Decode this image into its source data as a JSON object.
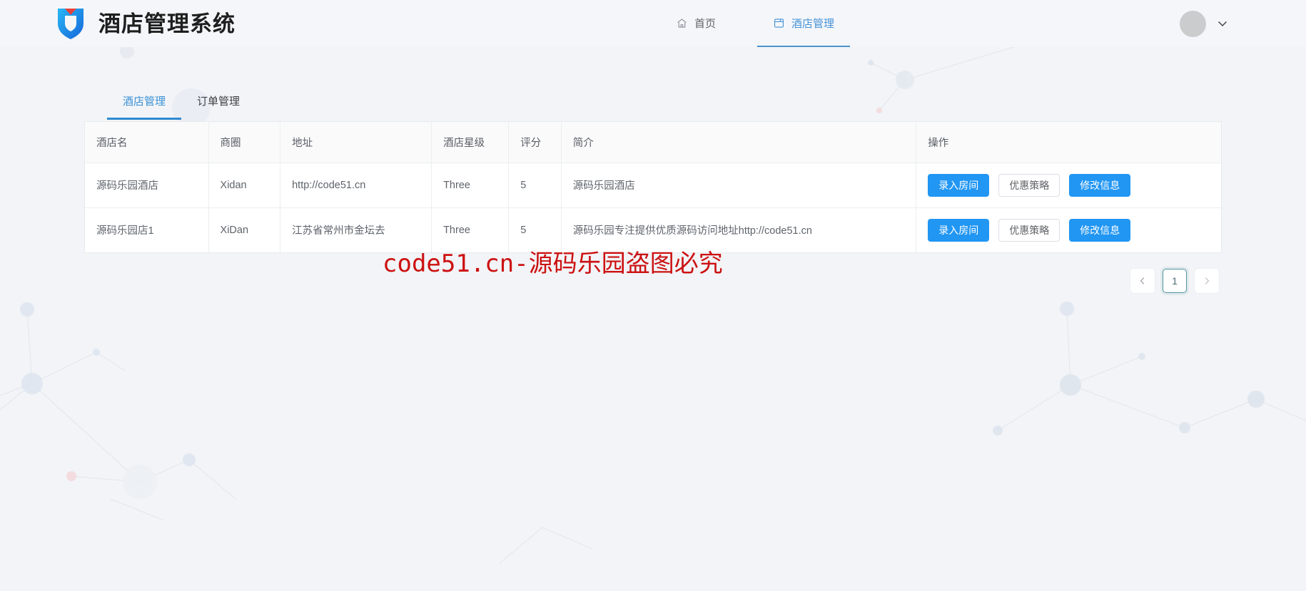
{
  "header": {
    "logo_icon": "shield-v-logo-icon",
    "title": "酒店管理系统",
    "nav": [
      {
        "label": "首页",
        "icon": "home-icon",
        "active": false
      },
      {
        "label": "酒店管理",
        "icon": "window-icon",
        "active": true
      }
    ],
    "user": {
      "avatar_icon": "avatar-placeholder-icon",
      "chevron_icon": "chevron-down-icon"
    }
  },
  "tabs": [
    {
      "label": "酒店管理",
      "active": true
    },
    {
      "label": "订单管理",
      "active": false
    }
  ],
  "table": {
    "columns": [
      "酒店名",
      "商圈",
      "地址",
      "酒店星级",
      "评分",
      "简介",
      "操作"
    ],
    "rows": [
      {
        "name": "源码乐园酒店",
        "area": "Xidan",
        "address": "http://code51.cn",
        "star": "Three",
        "score": "5",
        "desc": "源码乐园酒店",
        "ops": [
          "录入房间",
          "优惠策略",
          "修改信息"
        ]
      },
      {
        "name": "源码乐园店1",
        "area": "XiDan",
        "address": "江苏省常州市金坛去",
        "star": "Three",
        "score": "5",
        "desc": "源码乐园专注提供优质源码访问地址http://code51.cn",
        "ops": [
          "录入房间",
          "优惠策略",
          "修改信息"
        ]
      }
    ]
  },
  "pagination": {
    "prev_icon": "chevron-left-icon",
    "next_icon": "chevron-right-icon",
    "pages": [
      "1"
    ],
    "current": "1"
  },
  "watermark": {
    "text": "code51.cn-源码乐园盗图必究",
    "color": "#cc1111"
  },
  "colors": {
    "page_bg": "#f2f4f7",
    "accent_blue": "#2196f3",
    "nav_active": "#4793d8",
    "tab_active": "#3a90d4",
    "pager_active_border": "#53919f"
  }
}
